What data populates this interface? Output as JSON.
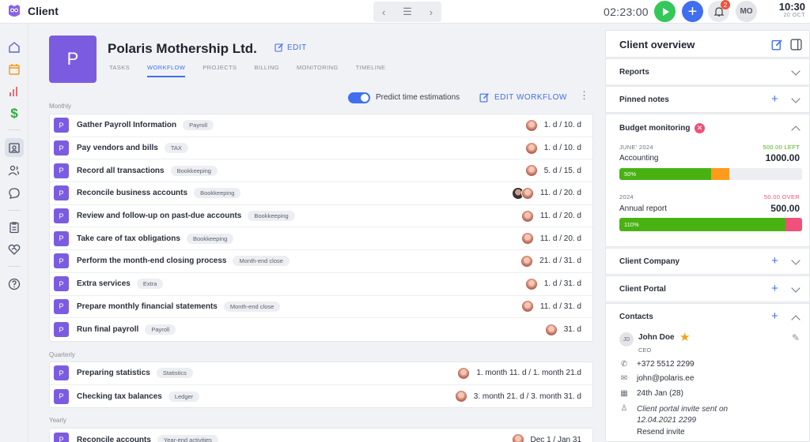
{
  "app": {
    "title": "Client",
    "timer": "02:23:00",
    "notifications": "2",
    "user_initials": "MO",
    "clock_time": "10:30",
    "clock_date": "20 OCT"
  },
  "colors": {
    "accent": "#3f6ff0",
    "client_avatar": "#7b5ce0",
    "progress_green": "#49b213",
    "over_budget": "#f0507a",
    "warn_orange": "#ff9a1a"
  },
  "sidebar": {
    "icons": [
      "home-icon",
      "calendar-icon",
      "bar-chart-icon",
      "dollar-icon",
      "client-icon",
      "users-icon",
      "chat-icon",
      "clipboard-icon",
      "heart-handshake-icon",
      "help-icon"
    ]
  },
  "client": {
    "avatar_letter": "P",
    "name": "Polaris Mothership Ltd.",
    "edit_label": "EDIT",
    "tabs": [
      "TASKS",
      "WORKFLOW",
      "PROJECTS",
      "BILLING",
      "MONITORING",
      "TIMELINE"
    ],
    "active_tab": "WORKFLOW"
  },
  "workflow": {
    "predict_label": "Predict time estimations",
    "predict_on": true,
    "edit_workflow_label": "EDIT WORKFLOW",
    "monthly_label": "Monthly",
    "quarterly_label": "Quarterly",
    "yearly_label": "Yearly",
    "monthly": [
      {
        "p": "P",
        "name": "Gather Payroll Information",
        "tag": "Payroll",
        "dur": "1. d / 10. d"
      },
      {
        "p": "P",
        "name": "Pay vendors and bills",
        "tag": "TAX",
        "dur": "1. d / 10. d"
      },
      {
        "p": "P",
        "name": "Record all transactions",
        "tag": "Bookkeeping",
        "dur": "5. d / 15. d"
      },
      {
        "p": "P",
        "name": "Reconcile business accounts",
        "tag": "Bookkeeping",
        "dur": "11. d / 20. d"
      },
      {
        "p": "P",
        "name": "Review and follow-up on past-due accounts",
        "tag": "Bookkeeping",
        "dur": "11. d / 20. d"
      },
      {
        "p": "P",
        "name": "Take care of tax obligations",
        "tag": "Bookkeeping",
        "dur": "11. d / 20. d"
      },
      {
        "p": "P",
        "name": "Perform the month-end closing process",
        "tag": "Month-end close",
        "dur": "21. d / 31. d"
      },
      {
        "p": "P",
        "name": "Extra services",
        "tag": "Extra",
        "dur": "1. d / 31. d"
      },
      {
        "p": "P",
        "name": "Prepare monthly financial statements",
        "tag": "Month-end close",
        "dur": "11. d / 31. d"
      },
      {
        "p": "P",
        "name": "Run final payroll",
        "tag": "Payroll",
        "dur": "31. d"
      }
    ],
    "quarterly": [
      {
        "p": "P",
        "name": "Preparing statistics",
        "tag": "Statistics",
        "dur": "1. month 11. d / 1. month 21.d"
      },
      {
        "p": "P",
        "name": "Checking tax balances",
        "tag": "Ledger",
        "dur": "3. month 21. d / 3. month 31. d"
      }
    ],
    "yearly": [
      {
        "p": "P",
        "name": "Reconcile accounts",
        "tag": "Year-end activities",
        "dur": "Dec 1 / Jan 31"
      }
    ]
  },
  "overview": {
    "title": "Client overview",
    "reports": "Reports",
    "pinned_notes": "Pinned notes",
    "budget_title": "Budget monitoring",
    "budget1": {
      "period": "JUNE' 2024",
      "status": "500.00 LEFT",
      "label": "Accounting",
      "amount": "1000.00",
      "bar_text": "50%",
      "fill_fraction": 0.5,
      "extra_fraction": 0.1
    },
    "budget2": {
      "period": "2024",
      "status": "50.00 OVER",
      "label": "Annual report",
      "amount": "500.00",
      "bar_text": "110%",
      "fill_fraction": 0.91,
      "over_fraction": 0.09
    },
    "client_company": "Client Company",
    "client_portal": "Client Portal",
    "contacts": "Contacts",
    "contact": {
      "initials": "JD",
      "name": "John Doe",
      "role": "CEO",
      "phone": "+372 5512 2299",
      "email": "john@polaris.ee",
      "birthday": "24th Jan (28)",
      "invite_line1": "Client portal invite sent on",
      "invite_line2": "12.04.2021 2299",
      "resend": "Resend invite"
    }
  }
}
